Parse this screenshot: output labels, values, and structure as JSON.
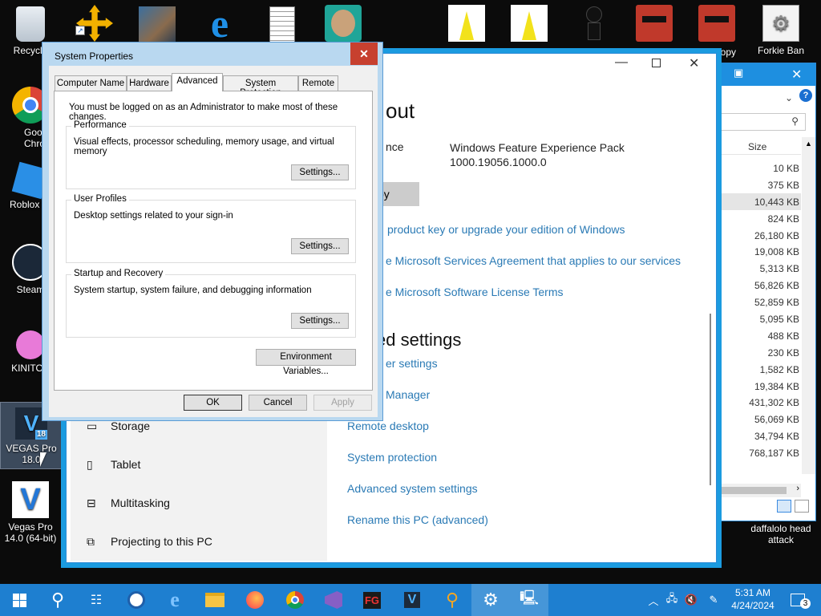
{
  "desktop_icons": {
    "recycle_bin": "Recycle",
    "chrome": "Googl Chrom",
    "roblox": "Roblox St",
    "steam": "Steam",
    "kinitopet": "KINITOP",
    "vegas18": "VEGAS Pro 18.0",
    "vegas14": "Vegas Pro 14.0 (64-bit)",
    "copy": "Copy",
    "forkie": "Forkie Ban",
    "daffalolo": "daffalolo head attack",
    "vegas18_badge": "18",
    "vegas18_letter": "V"
  },
  "settings_window": {
    "about_heading": "out",
    "edition_label": "nce",
    "experience_value_1": "Windows Feature Experience Pack",
    "experience_value_2": "1000.19056.1000.0",
    "copy_button": "py",
    "link_product_key": "product key or upgrade your edition of Windows",
    "link_services": "e Microsoft Services Agreement that applies to our services",
    "link_license": "e Microsoft Software License Terms",
    "related_heading": "ed settings",
    "link_bitlocker": "er settings",
    "link_device_manager": "Manager",
    "link_remote": "Remote desktop",
    "link_protection": "System protection",
    "link_advanced": "Advanced system settings",
    "link_rename": "Rename this PC (advanced)",
    "nav": [
      "Storage",
      "Tablet",
      "Multitasking",
      "Projecting to this PC"
    ]
  },
  "system_properties": {
    "title": "System Properties",
    "close": "✕",
    "tabs": [
      "Computer Name",
      "Hardware",
      "Advanced",
      "System Protection",
      "Remote"
    ],
    "admin_note": "You must be logged on as an Administrator to make most of these changes.",
    "performance": {
      "title": "Performance",
      "desc": "Visual effects, processor scheduling, memory usage, and virtual memory",
      "button": "Settings..."
    },
    "user_profiles": {
      "title": "User Profiles",
      "desc": "Desktop settings related to your sign-in",
      "button": "Settings..."
    },
    "startup": {
      "title": "Startup and Recovery",
      "desc": "System startup, system failure, and debugging information",
      "button": "Settings..."
    },
    "env_button": "Environment Variables...",
    "ok": "OK",
    "cancel": "Cancel",
    "apply": "Apply"
  },
  "explorer": {
    "column": "Size",
    "sizes": [
      "10 KB",
      "375 KB",
      "10,443 KB",
      "824 KB",
      "26,180 KB",
      "19,008 KB",
      "5,313 KB",
      "56,826 KB",
      "52,859 KB",
      "5,095 KB",
      "488 KB",
      "230 KB",
      "1,582 KB",
      "19,384 KB",
      "431,302 KB",
      "56,069 KB",
      "34,794 KB",
      "768,187 KB"
    ]
  },
  "taskbar": {
    "time": "5:31 AM",
    "date": "4/24/2024",
    "notifications": "3",
    "fg_label": "FG"
  },
  "colors": {
    "taskbar": "#1e7fd0",
    "link": "#2a7ab5",
    "close_red": "#c7402f"
  }
}
